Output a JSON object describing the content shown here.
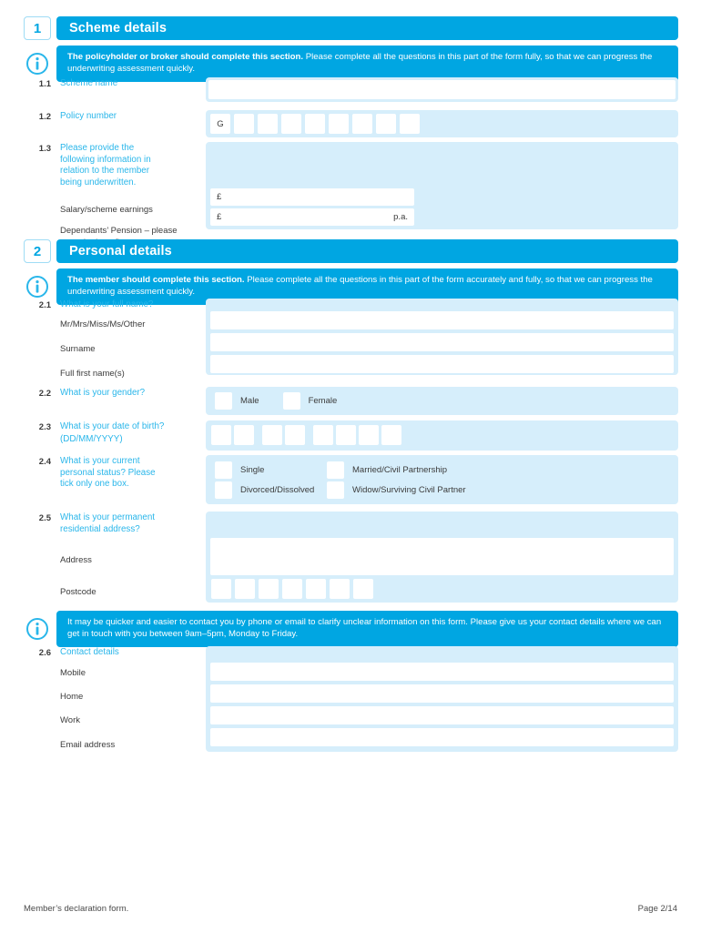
{
  "sections": [
    {
      "number": "1",
      "title": "Scheme details",
      "info_bold": "The policyholder or broker should complete this section.",
      "info_rest": " Please complete all the questions in this part of the form fully, so that we can progress the underwriting assessment quickly."
    },
    {
      "number": "2",
      "title": "Personal details",
      "info_bold": "The member should complete this section.",
      "info_rest": " Please complete all the questions in this part of the form accurately and fully, so that we can progress the underwriting assessment quickly."
    }
  ],
  "q11": {
    "num": "1.1",
    "label": "Scheme name",
    "value": ""
  },
  "q12": {
    "num": "1.2",
    "label": "Policy number",
    "prefix": "G",
    "boxes": 8
  },
  "q13": {
    "num": "1.3",
    "label": "Please provide the following information in relation to the member being underwritten.",
    "salary_label": "Salary/scheme earnings",
    "salary_currency": "£",
    "salary_value": "",
    "dependants_label": "Dependants’ Pension – please state the benefit amount",
    "dependants_currency": "£",
    "dependants_value": "",
    "dependants_suffix": "p.a."
  },
  "q21": {
    "num": "2.1",
    "label": "What is your full name?",
    "rows": [
      {
        "label": "Mr/Mrs/Miss/Ms/Other",
        "value": ""
      },
      {
        "label": "Surname",
        "value": ""
      },
      {
        "label": "Full first name(s)",
        "value": ""
      }
    ]
  },
  "q22": {
    "num": "2.2",
    "label": "What is your gender?",
    "options": [
      "Male",
      "Female"
    ]
  },
  "q23": {
    "num": "2.3",
    "label": "What is your date of birth?",
    "label2": "(DD/MM/YYYY)",
    "groups": [
      2,
      2,
      4
    ]
  },
  "q24": {
    "num": "2.4",
    "label": "What is your current personal status? Please tick only one box.",
    "options": [
      "Single",
      "Married/Civil Partnership",
      "Divorced/Dissolved",
      "Widow/Surviving Civil Partner"
    ]
  },
  "q25": {
    "num": "2.5",
    "label": "What is your permanent residential address?",
    "address_label": "Address",
    "address_value": "",
    "postcode_label": "Postcode",
    "postcode_boxes": 7
  },
  "contact_info": "It may be quicker and easier to contact you by phone or email to clarify unclear information on this form. Please give us your contact details where we can get in touch with you between 9am–5pm, Monday to Friday.",
  "q26": {
    "num": "2.6",
    "label": "Contact details",
    "rows": [
      {
        "label": "Mobile",
        "value": ""
      },
      {
        "label": "Home",
        "value": ""
      },
      {
        "label": "Work",
        "value": ""
      },
      {
        "label": "Email address",
        "value": ""
      }
    ]
  },
  "footer": {
    "left": "Member’s declaration form.",
    "right": "Page 2/14"
  },
  "icons": {
    "info": "info-icon"
  },
  "colors": {
    "accent": "#00a6e2",
    "panel": "#d6eefb",
    "label": "#29b6ea"
  }
}
